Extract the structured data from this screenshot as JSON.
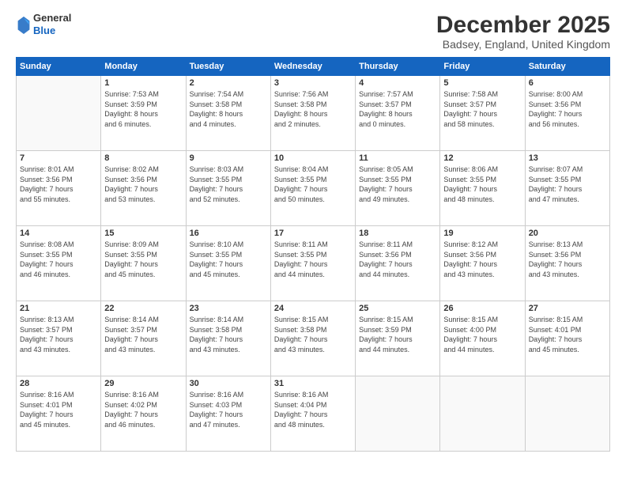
{
  "logo": {
    "general": "General",
    "blue": "Blue"
  },
  "header": {
    "title": "December 2025",
    "subtitle": "Badsey, England, United Kingdom"
  },
  "weekdays": [
    "Sunday",
    "Monday",
    "Tuesday",
    "Wednesday",
    "Thursday",
    "Friday",
    "Saturday"
  ],
  "weeks": [
    [
      {
        "day": "",
        "info": ""
      },
      {
        "day": "1",
        "info": "Sunrise: 7:53 AM\nSunset: 3:59 PM\nDaylight: 8 hours\nand 6 minutes."
      },
      {
        "day": "2",
        "info": "Sunrise: 7:54 AM\nSunset: 3:58 PM\nDaylight: 8 hours\nand 4 minutes."
      },
      {
        "day": "3",
        "info": "Sunrise: 7:56 AM\nSunset: 3:58 PM\nDaylight: 8 hours\nand 2 minutes."
      },
      {
        "day": "4",
        "info": "Sunrise: 7:57 AM\nSunset: 3:57 PM\nDaylight: 8 hours\nand 0 minutes."
      },
      {
        "day": "5",
        "info": "Sunrise: 7:58 AM\nSunset: 3:57 PM\nDaylight: 7 hours\nand 58 minutes."
      },
      {
        "day": "6",
        "info": "Sunrise: 8:00 AM\nSunset: 3:56 PM\nDaylight: 7 hours\nand 56 minutes."
      }
    ],
    [
      {
        "day": "7",
        "info": "Sunrise: 8:01 AM\nSunset: 3:56 PM\nDaylight: 7 hours\nand 55 minutes."
      },
      {
        "day": "8",
        "info": "Sunrise: 8:02 AM\nSunset: 3:56 PM\nDaylight: 7 hours\nand 53 minutes."
      },
      {
        "day": "9",
        "info": "Sunrise: 8:03 AM\nSunset: 3:55 PM\nDaylight: 7 hours\nand 52 minutes."
      },
      {
        "day": "10",
        "info": "Sunrise: 8:04 AM\nSunset: 3:55 PM\nDaylight: 7 hours\nand 50 minutes."
      },
      {
        "day": "11",
        "info": "Sunrise: 8:05 AM\nSunset: 3:55 PM\nDaylight: 7 hours\nand 49 minutes."
      },
      {
        "day": "12",
        "info": "Sunrise: 8:06 AM\nSunset: 3:55 PM\nDaylight: 7 hours\nand 48 minutes."
      },
      {
        "day": "13",
        "info": "Sunrise: 8:07 AM\nSunset: 3:55 PM\nDaylight: 7 hours\nand 47 minutes."
      }
    ],
    [
      {
        "day": "14",
        "info": "Sunrise: 8:08 AM\nSunset: 3:55 PM\nDaylight: 7 hours\nand 46 minutes."
      },
      {
        "day": "15",
        "info": "Sunrise: 8:09 AM\nSunset: 3:55 PM\nDaylight: 7 hours\nand 45 minutes."
      },
      {
        "day": "16",
        "info": "Sunrise: 8:10 AM\nSunset: 3:55 PM\nDaylight: 7 hours\nand 45 minutes."
      },
      {
        "day": "17",
        "info": "Sunrise: 8:11 AM\nSunset: 3:55 PM\nDaylight: 7 hours\nand 44 minutes."
      },
      {
        "day": "18",
        "info": "Sunrise: 8:11 AM\nSunset: 3:56 PM\nDaylight: 7 hours\nand 44 minutes."
      },
      {
        "day": "19",
        "info": "Sunrise: 8:12 AM\nSunset: 3:56 PM\nDaylight: 7 hours\nand 43 minutes."
      },
      {
        "day": "20",
        "info": "Sunrise: 8:13 AM\nSunset: 3:56 PM\nDaylight: 7 hours\nand 43 minutes."
      }
    ],
    [
      {
        "day": "21",
        "info": "Sunrise: 8:13 AM\nSunset: 3:57 PM\nDaylight: 7 hours\nand 43 minutes."
      },
      {
        "day": "22",
        "info": "Sunrise: 8:14 AM\nSunset: 3:57 PM\nDaylight: 7 hours\nand 43 minutes."
      },
      {
        "day": "23",
        "info": "Sunrise: 8:14 AM\nSunset: 3:58 PM\nDaylight: 7 hours\nand 43 minutes."
      },
      {
        "day": "24",
        "info": "Sunrise: 8:15 AM\nSunset: 3:58 PM\nDaylight: 7 hours\nand 43 minutes."
      },
      {
        "day": "25",
        "info": "Sunrise: 8:15 AM\nSunset: 3:59 PM\nDaylight: 7 hours\nand 44 minutes."
      },
      {
        "day": "26",
        "info": "Sunrise: 8:15 AM\nSunset: 4:00 PM\nDaylight: 7 hours\nand 44 minutes."
      },
      {
        "day": "27",
        "info": "Sunrise: 8:15 AM\nSunset: 4:01 PM\nDaylight: 7 hours\nand 45 minutes."
      }
    ],
    [
      {
        "day": "28",
        "info": "Sunrise: 8:16 AM\nSunset: 4:01 PM\nDaylight: 7 hours\nand 45 minutes."
      },
      {
        "day": "29",
        "info": "Sunrise: 8:16 AM\nSunset: 4:02 PM\nDaylight: 7 hours\nand 46 minutes."
      },
      {
        "day": "30",
        "info": "Sunrise: 8:16 AM\nSunset: 4:03 PM\nDaylight: 7 hours\nand 47 minutes."
      },
      {
        "day": "31",
        "info": "Sunrise: 8:16 AM\nSunset: 4:04 PM\nDaylight: 7 hours\nand 48 minutes."
      },
      {
        "day": "",
        "info": ""
      },
      {
        "day": "",
        "info": ""
      },
      {
        "day": "",
        "info": ""
      }
    ]
  ]
}
